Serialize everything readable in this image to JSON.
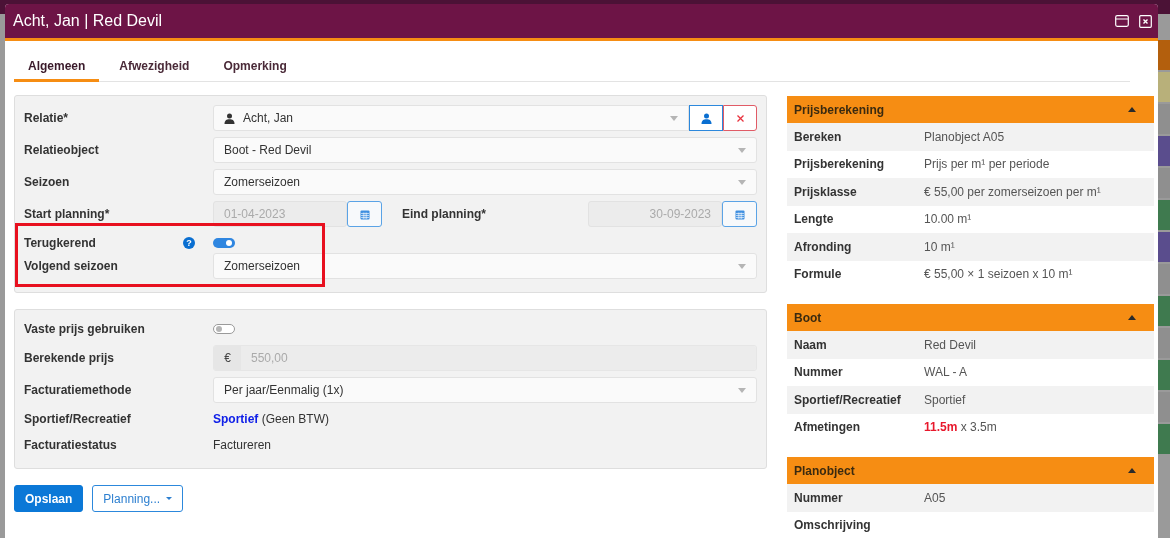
{
  "window": {
    "title": "Acht, Jan | Red Devil"
  },
  "tabs": [
    {
      "label": "Algemeen",
      "selected": true
    },
    {
      "label": "Afwezigheid",
      "selected": false
    },
    {
      "label": "Opmerking",
      "selected": false
    }
  ],
  "planning_section": {
    "fields": [
      {
        "kind": "relation",
        "label": "Relatie*",
        "value": "Acht, Jan",
        "highlighted": false
      },
      {
        "kind": "select",
        "label": "Relatieobject",
        "value": "Boot - Red Devil",
        "highlighted": false
      },
      {
        "kind": "select",
        "label": "Seizoen",
        "value": "Zomerseizoen",
        "highlighted": false
      },
      {
        "kind": "dates",
        "label": "Start planning*",
        "value": "01-04-2023",
        "label_2": "Eind planning*",
        "value_2": "30-09-2023",
        "disabled": true,
        "highlighted": false
      },
      {
        "kind": "toggle",
        "label": "Terugkerend",
        "help": "?",
        "on": true,
        "highlighted": true
      },
      {
        "kind": "select",
        "label": "Volgend seizoen",
        "value": "Zomerseizoen",
        "highlighted": true
      }
    ]
  },
  "price_section": {
    "fields": [
      {
        "kind": "toggle",
        "label": "Vaste prijs gebruiken",
        "on": false
      },
      {
        "kind": "currency",
        "label": "Berekende prijs",
        "prefix": "€",
        "value": "550,00",
        "disabled": true
      },
      {
        "kind": "select",
        "label": "Facturatiemethode",
        "value": "Per jaar/Eenmalig (1x)"
      },
      {
        "kind": "text",
        "label": "Sportief/Recreatief",
        "value": "**Sportief** (Geen BTW)"
      },
      {
        "kind": "text",
        "label": "Facturatiestatus",
        "value": "Factureren"
      }
    ]
  },
  "buttons": [
    {
      "label": "Opslaan",
      "kind": "primary"
    },
    {
      "label": "Planning...",
      "kind": "dropdown"
    }
  ],
  "info_panels": [
    {
      "title": "Prijsberekening",
      "expanded": true,
      "rows": [
        {
          "label": "Bereken",
          "value": "Planobject A05"
        },
        {
          "label": "Prijsberekening",
          "value": "Prijs per m¹ per periode"
        },
        {
          "label": "Prijsklasse",
          "value": "€ 55,00 per zomerseizoen per m¹"
        },
        {
          "label": "Lengte",
          "value": "10.00 m¹"
        },
        {
          "label": "Afronding",
          "value": "10 m¹"
        },
        {
          "label": "Formule",
          "value": "€ 55,00 × 1 seizoen x 10 m¹"
        }
      ]
    },
    {
      "title": "Boot",
      "expanded": true,
      "rows": [
        {
          "label": "Naam",
          "value": "Red Devil"
        },
        {
          "label": "Nummer",
          "value": "WAL - A"
        },
        {
          "label": "Sportief/Recreatief",
          "value": "Sportief"
        },
        {
          "label": "Afmetingen",
          "value": "**11.5m** x 3.5m"
        }
      ]
    },
    {
      "title": "Planobject",
      "expanded": true,
      "rows": [
        {
          "label": "Nummer",
          "value": "A05"
        },
        {
          "label": "Omschrijving"
        }
      ]
    }
  ]
}
